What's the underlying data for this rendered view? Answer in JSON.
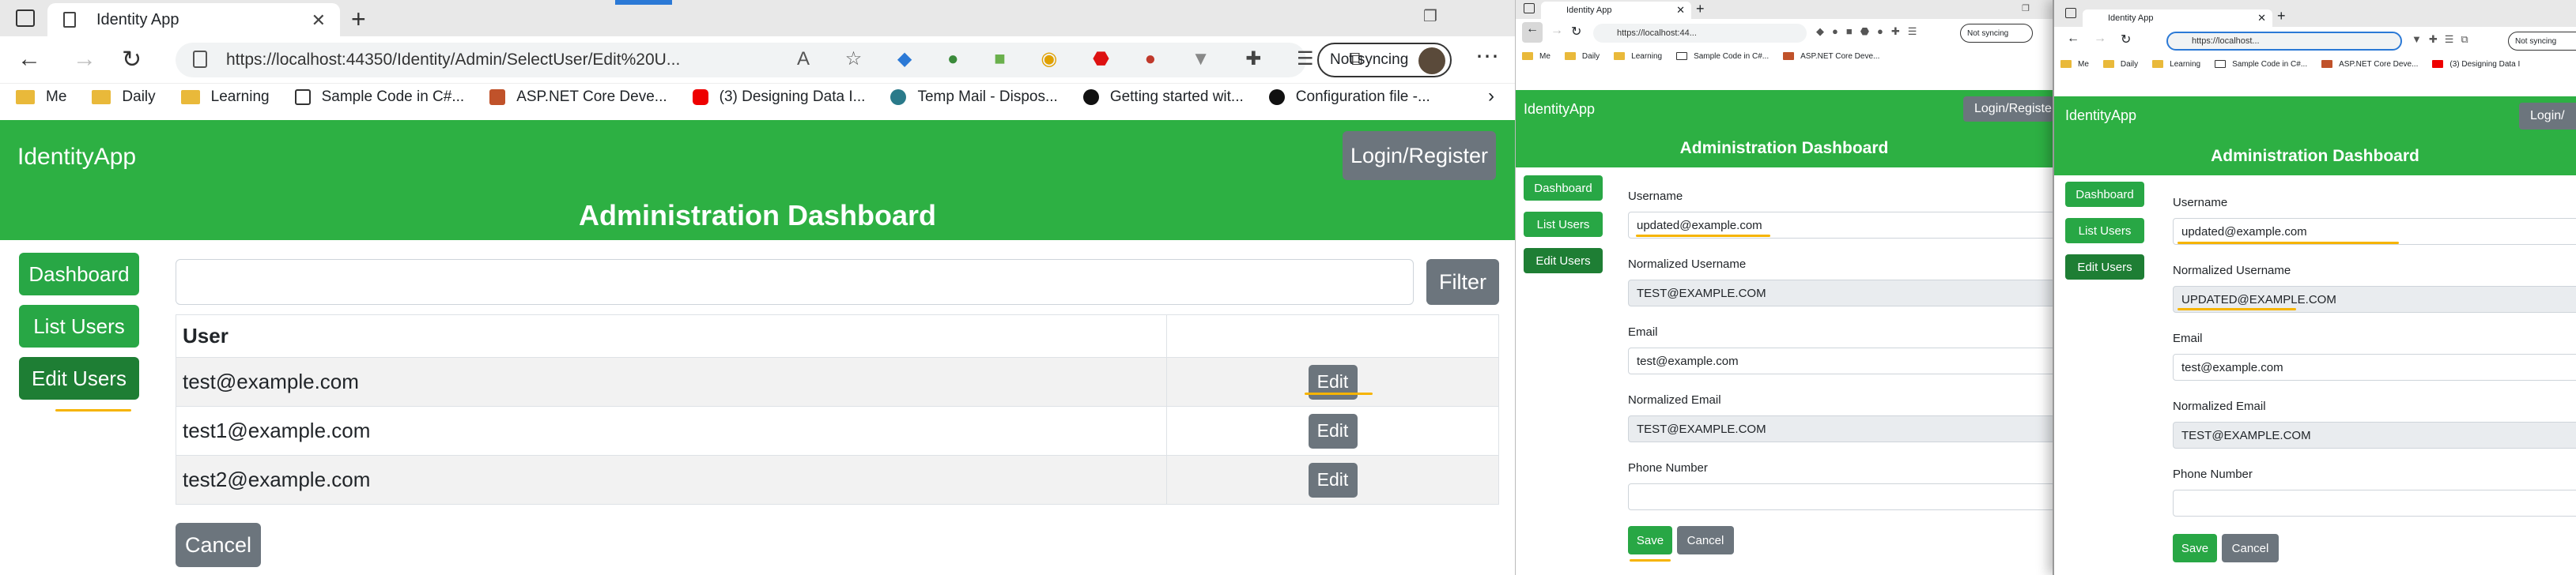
{
  "colors": {
    "primary_green": "#28a745",
    "navbar_green": "#2db043",
    "active_green": "#1e7e34",
    "secondary_gray": "#6c757d",
    "highlight_underline": "#f6b400"
  },
  "browser": {
    "tab_title": "Identity App",
    "url_large": "https://localhost:44350/Identity/Admin/SelectUser/Edit%20U...",
    "url_mid": "https://localhost:44...",
    "url_small": "https://localhost...",
    "sync_label": "Not syncing",
    "bookmarks": [
      "Me",
      "Daily",
      "Learning",
      "Sample Code in C#...",
      "ASP.NET Core Deve...",
      "(3) Designing Data I...",
      "Temp Mail - Dispos...",
      "Getting started wit...",
      "Configuration file -..."
    ],
    "bookmarks_small_mid": [
      "Me",
      "Daily",
      "Learning",
      "Sample Code in C#...",
      "ASP.NET Core Deve..."
    ],
    "bookmarks_small_right": [
      "Me",
      "Daily",
      "Learning",
      "Sample Code in C#...",
      "ASP.NET Core Deve...",
      "(3) Designing Data I"
    ]
  },
  "app": {
    "brand": "IdentityApp",
    "login_label": "Login/Register",
    "login_label_mid": "Login/Registe",
    "login_label_right": "Login/",
    "dashboard_title": "Administration Dashboard",
    "sidebar": [
      {
        "label": "Dashboard"
      },
      {
        "label": "List Users"
      },
      {
        "label": "Edit Users"
      }
    ]
  },
  "list_view": {
    "filter_value": "",
    "filter_label": "Filter",
    "column_user": "User",
    "column_action": "",
    "rows": [
      {
        "user": "test@example.com",
        "action": "Edit"
      },
      {
        "user": "test1@example.com",
        "action": "Edit"
      },
      {
        "user": "test2@example.com",
        "action": "Edit"
      }
    ],
    "cancel_label": "Cancel"
  },
  "edit_form_mid": {
    "username_label": "Username",
    "username_value": "updated@example.com",
    "normalized_username_label": "Normalized Username",
    "normalized_username_value": "TEST@EXAMPLE.COM",
    "email_label": "Email",
    "email_value": "test@example.com",
    "normalized_email_label": "Normalized Email",
    "normalized_email_value": "TEST@EXAMPLE.COM",
    "phone_label": "Phone Number",
    "phone_value": "",
    "save_label": "Save",
    "cancel_label": "Cancel"
  },
  "edit_form_right": {
    "username_label": "Username",
    "username_value": "updated@example.com",
    "normalized_username_label": "Normalized Username",
    "normalized_username_value": "UPDATED@EXAMPLE.COM",
    "email_label": "Email",
    "email_value": "test@example.com",
    "normalized_email_label": "Normalized Email",
    "normalized_email_value": "TEST@EXAMPLE.COM",
    "phone_label": "Phone Number",
    "phone_value": "",
    "save_label": "Save",
    "cancel_label": "Cancel"
  }
}
